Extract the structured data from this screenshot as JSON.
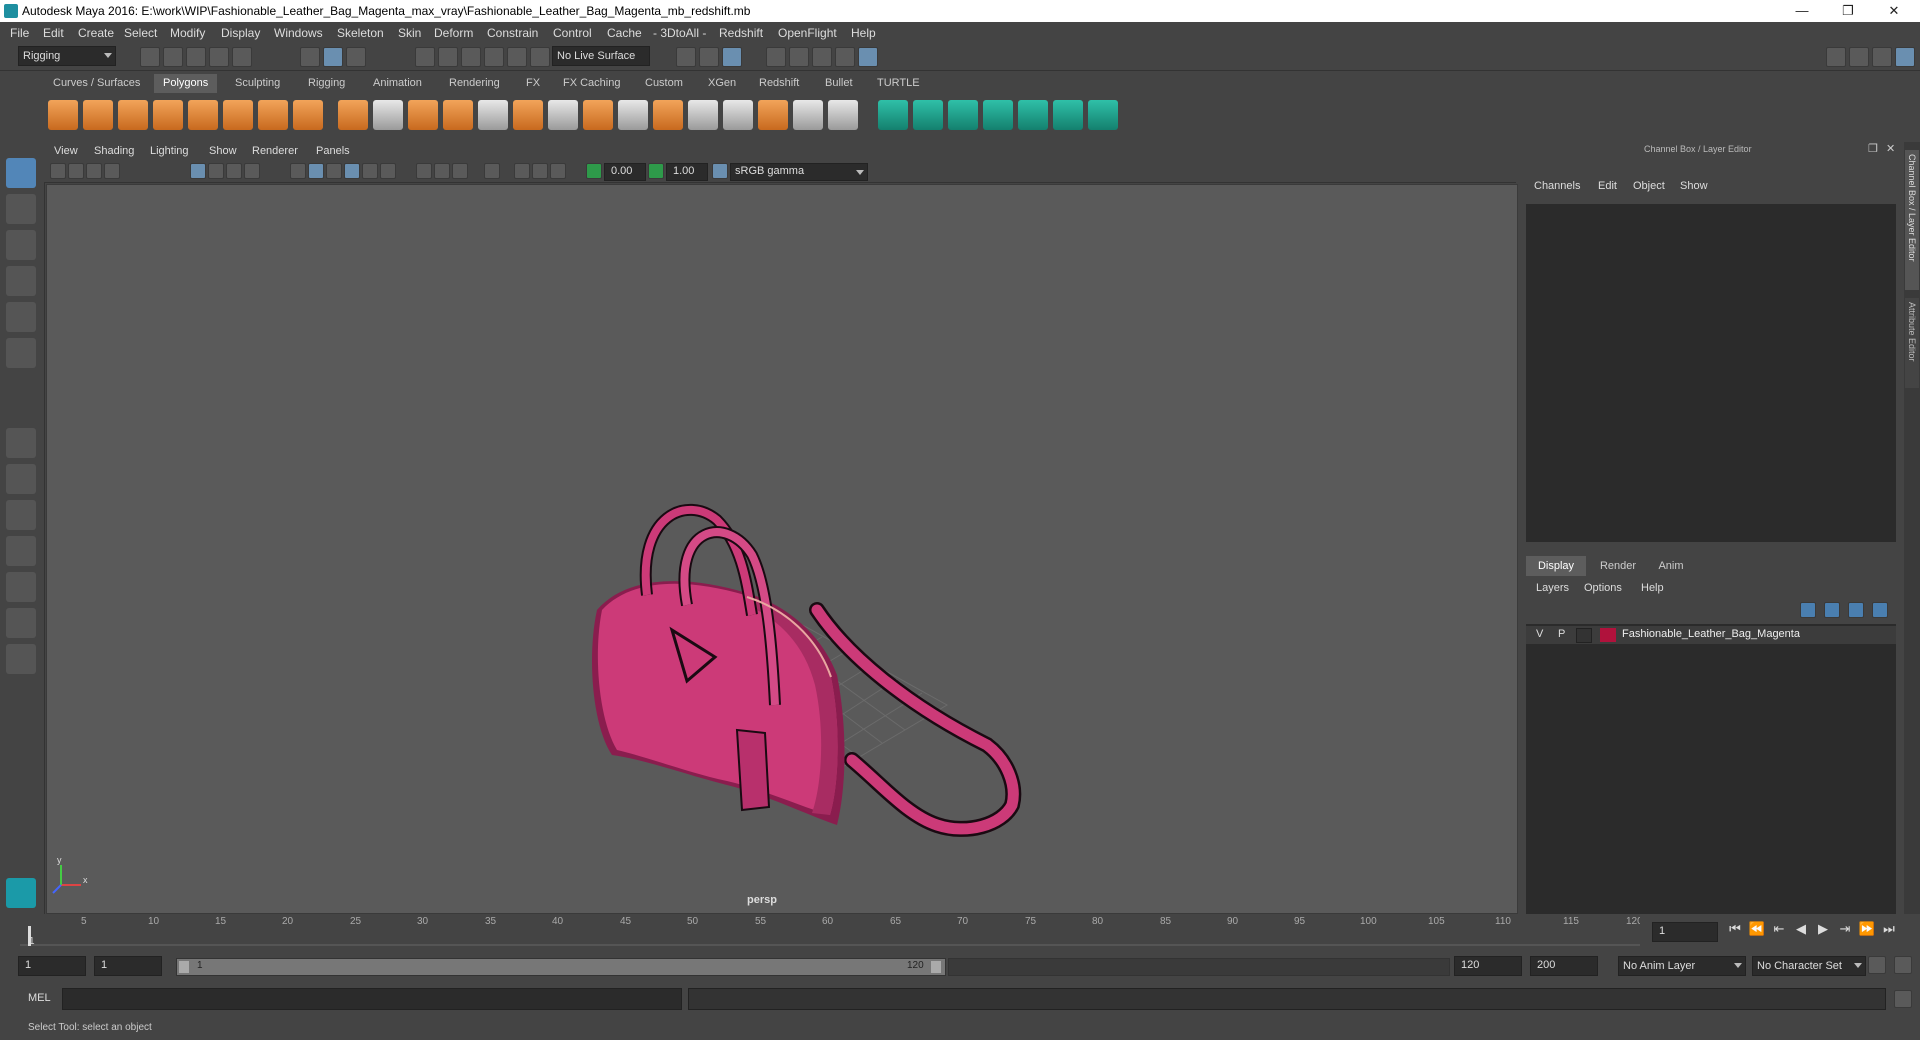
{
  "window": {
    "title": "Autodesk Maya 2016: E:\\work\\WIP\\Fashionable_Leather_Bag_Magenta_max_vray\\Fashionable_Leather_Bag_Magenta_mb_redshift.mb",
    "min": "—",
    "restore": "❐",
    "close": "✕"
  },
  "menubar": [
    "File",
    "Edit",
    "Create",
    "Select",
    "Modify",
    "Display",
    "Windows",
    "Skeleton",
    "Skin",
    "Deform",
    "Constrain",
    "Control",
    "Cache",
    "- 3DtoAll -",
    "Redshift",
    "OpenFlight",
    "Help"
  ],
  "status": {
    "mode": "Rigging",
    "live_surface": "No Live Surface"
  },
  "shelf_tabs": [
    "Curves / Surfaces",
    "Polygons",
    "Sculpting",
    "Rigging",
    "Animation",
    "Rendering",
    "FX",
    "FX Caching",
    "Custom",
    "XGen",
    "Redshift",
    "Bullet",
    "TURTLE"
  ],
  "shelf_active": "Polygons",
  "viewport": {
    "menus": [
      "View",
      "Shading",
      "Lighting",
      "Show",
      "Renderer",
      "Panels"
    ],
    "exposure": "0.00",
    "gamma": "1.00",
    "colorspace": "sRGB gamma",
    "camera_label": "persp",
    "axis_x": "x",
    "axis_y": "y"
  },
  "channel_box": {
    "title": "Channel Box / Layer Editor",
    "menus": [
      "Channels",
      "Edit",
      "Object",
      "Show"
    ],
    "side_tab_1": "Channel Box / Layer Editor",
    "side_tab_2": "Attribute Editor"
  },
  "layer_editor": {
    "tabs": [
      "Display",
      "Render",
      "Anim"
    ],
    "active_tab": "Display",
    "menus": [
      "Layers",
      "Options",
      "Help"
    ],
    "layer": {
      "v": "V",
      "p": "P",
      "name": "Fashionable_Leather_Bag_Magenta",
      "color": "#b0123c"
    }
  },
  "timeline": {
    "ticks": [
      "5",
      "10",
      "15",
      "20",
      "25",
      "30",
      "35",
      "40",
      "45",
      "50",
      "55",
      "60",
      "65",
      "70",
      "75",
      "80",
      "85",
      "90",
      "95",
      "100",
      "105",
      "110",
      "115",
      "120"
    ],
    "current_marker": "1",
    "current_frame": "1"
  },
  "range": {
    "start": "1",
    "anim_start": "1",
    "slider_start": "1",
    "slider_end": "120",
    "end": "120",
    "anim_end": "200",
    "anim_layer": "No Anim Layer",
    "char_set": "No Character Set"
  },
  "cmdline": {
    "label": "MEL"
  },
  "helpline": {
    "text": "Select Tool: select an object"
  },
  "colors": {
    "bag": "#cc3a78",
    "bag_dark": "#8a1d4e",
    "viewport_bg": "#5a5a5a",
    "accent_blue": "#5286b8"
  }
}
